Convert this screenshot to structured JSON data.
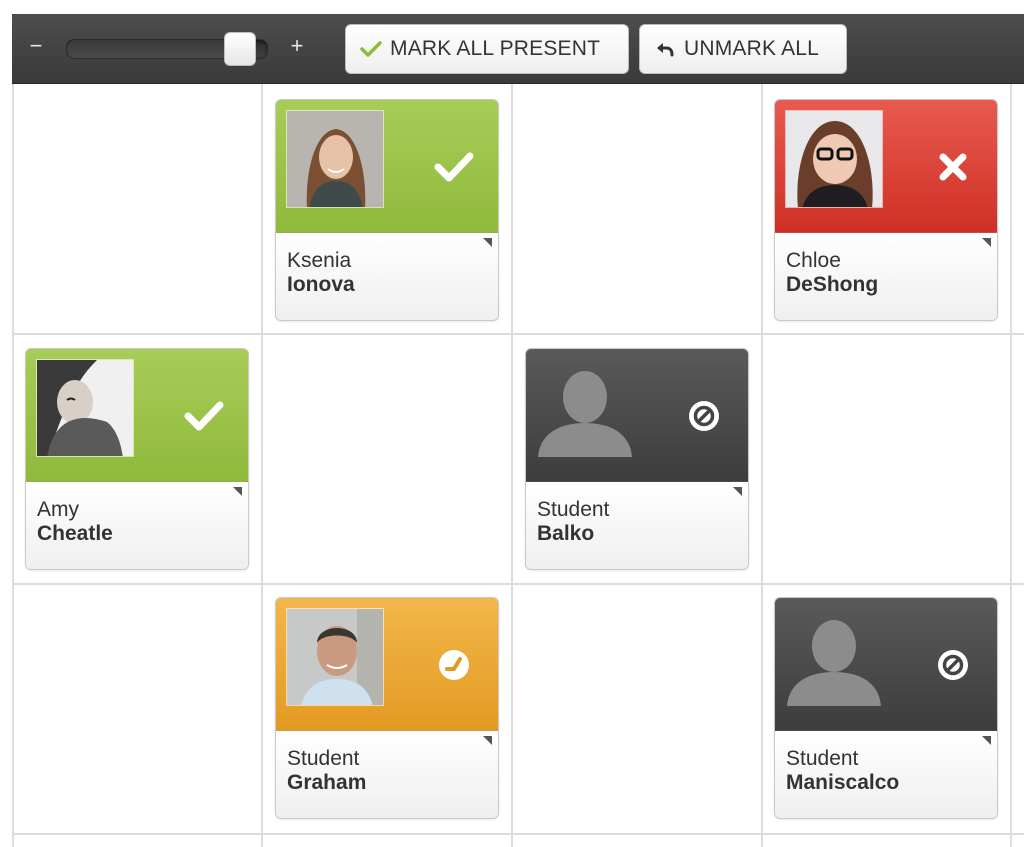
{
  "toolbar": {
    "zoom_minus": "−",
    "zoom_plus": "+",
    "zoom_level": 0.93,
    "mark_all_label": "MARK ALL PRESENT",
    "mark_all_icon": "check-icon",
    "unmark_all_label": "UNMARK ALL",
    "unmark_all_icon": "undo-arrow-icon"
  },
  "colors": {
    "present": "#98c147",
    "absent": "#d9392e",
    "late": "#eba632",
    "unmarked": "#4a4a4a"
  },
  "students": [
    {
      "first": "Ksenia",
      "last": "Ionova",
      "status": "present",
      "status_icon": "check-icon",
      "photo": "photo-woman-brown-hair"
    },
    {
      "first": "Chloe",
      "last": "DeShong",
      "status": "absent",
      "status_icon": "x-icon",
      "photo": "photo-woman-glasses"
    },
    {
      "first": "Amy",
      "last": "Cheatle",
      "status": "present",
      "status_icon": "check-icon",
      "photo": "photo-woman-sweater-bw"
    },
    {
      "first": "Student",
      "last": "Balko",
      "status": "unmarked",
      "status_icon": "no-entry-icon",
      "photo": "silhouette-placeholder"
    },
    {
      "first": "Student",
      "last": "Graham",
      "status": "late",
      "status_icon": "clock-icon",
      "photo": "photo-man-grey-hair"
    },
    {
      "first": "Student",
      "last": "Maniscalco",
      "status": "unmarked",
      "status_icon": "no-entry-icon",
      "photo": "silhouette-placeholder"
    }
  ]
}
